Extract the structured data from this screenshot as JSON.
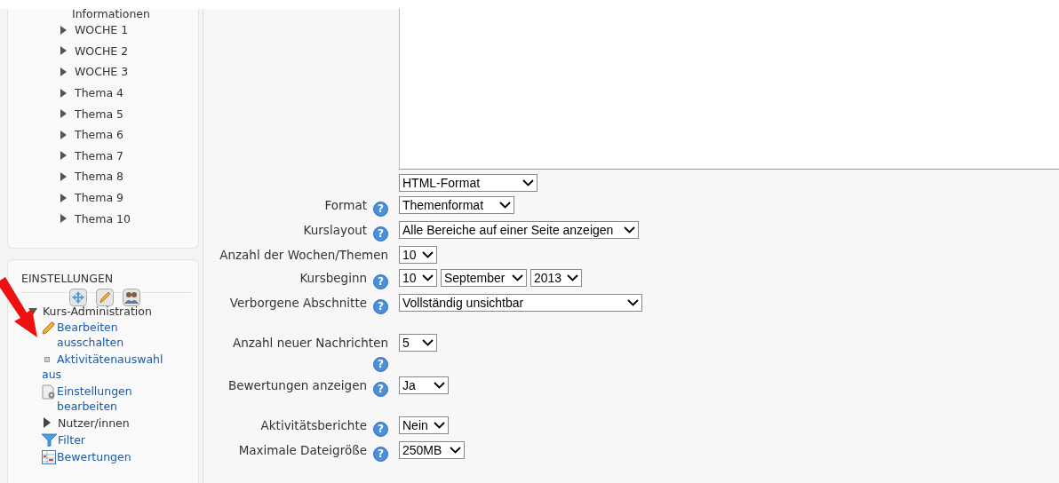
{
  "sidebar": {
    "course_sections": [
      {
        "label": "Informationen",
        "kind": "plain"
      },
      {
        "label": "WOCHE 1",
        "expanded": false,
        "kind": "branch"
      },
      {
        "label": "WOCHE 2",
        "expanded": false,
        "kind": "branch"
      },
      {
        "label": "WOCHE 3",
        "expanded": false,
        "kind": "branch"
      },
      {
        "label": "Thema 4",
        "expanded": false,
        "kind": "branch"
      },
      {
        "label": "Thema 5",
        "expanded": false,
        "kind": "branch"
      },
      {
        "label": "Thema 6",
        "expanded": false,
        "kind": "branch"
      },
      {
        "label": "Thema 7",
        "expanded": false,
        "kind": "branch"
      },
      {
        "label": "Thema 8",
        "expanded": false,
        "kind": "branch"
      },
      {
        "label": "Thema 9",
        "expanded": false,
        "kind": "branch"
      },
      {
        "label": "Thema 10",
        "expanded": false,
        "kind": "branch"
      }
    ],
    "settings": {
      "title": "EINSTELLUNGEN",
      "admin": {
        "label": "Kurs-Administration",
        "expanded": true,
        "items": [
          {
            "label": "Bearbeiten ausschalten",
            "kind": "icon-link"
          },
          {
            "label": "Aktivitätenauswahl aus",
            "kind": "bullet-link"
          },
          {
            "label": "Einstellungen bearbeiten",
            "kind": "icon-link"
          },
          {
            "label": "Nutzer/innen",
            "kind": "branch",
            "expanded": false
          },
          {
            "label": "Filter",
            "kind": "icon-link"
          },
          {
            "label": "Bewertungen",
            "kind": "icon-link"
          }
        ]
      }
    }
  },
  "form": {
    "field_groups": [
      [
        {
          "value": "HTML-Format",
          "kind": "select"
        },
        {
          "label": "Format",
          "help": "?",
          "value": "Themenformat",
          "kind": "select"
        },
        {
          "label": "Kurslayout",
          "help": "?",
          "value": "Alle Bereiche auf einer Seite anzeigen",
          "kind": "select"
        },
        {
          "label": "Anzahl der Wochen/Themen",
          "value": "10",
          "kind": "select"
        },
        {
          "label": "Kursbeginn",
          "help": "?",
          "values": [
            "10",
            "September",
            "2013"
          ],
          "kind": "date"
        },
        {
          "label": "Verborgene Abschnitte",
          "help": "?",
          "value": "Vollständig unsichtbar",
          "kind": "select"
        }
      ],
      [
        {
          "label": "Anzahl neuer Nachrichten",
          "help": "?",
          "value": "5",
          "kind": "select"
        },
        {
          "label": "Bewertungen anzeigen",
          "help": "?",
          "value": "Ja",
          "kind": "select"
        }
      ],
      [
        {
          "label": "Aktivitätsberichte",
          "help": "?",
          "value": "Nein",
          "kind": "select"
        },
        {
          "label": "Maximale Dateigröße",
          "help": "?",
          "value": "250MB",
          "kind": "select"
        }
      ]
    ]
  }
}
